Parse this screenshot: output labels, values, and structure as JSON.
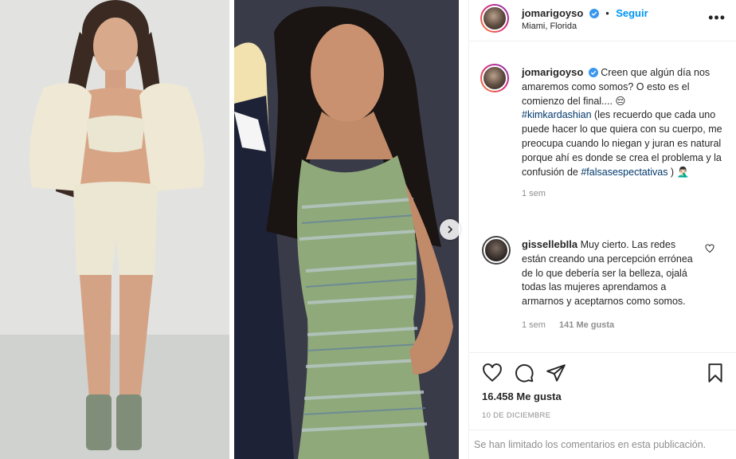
{
  "post": {
    "author": "jomarigoyso",
    "follow_label": "Seguir",
    "separator": "•",
    "location": "Miami, Florida",
    "more_label": "•••"
  },
  "caption": {
    "author": "jomarigoyso",
    "text_part1": "Creen que algún día nos amaremos como somos? O esto es el comienzo del final.... 😔",
    "hashtag1": "#kimkardashian",
    "text_part2": " (les recuerdo que cada uno puede hacer lo que quiera con su cuerpo, me preocupa cuando lo niegan y juran es natural porque ahí es donde se crea el problema y la confusión de ",
    "hashtag2": "#falsasespectativas",
    "text_part3": " ) 🤦🏻‍♂️",
    "time": "1 sem"
  },
  "comments": [
    {
      "author": "gissellebIla",
      "text": "Muy cierto. Las redes están creando una percepción errónea de lo que debería ser la belleza, ojalá todas las mujeres aprendamos a armarnos y aceptarnos como somos.",
      "time": "1 sem",
      "likes": "141 Me gusta"
    }
  ],
  "actions": {
    "likes": "16.458 Me gusta",
    "date": "10 DE DICIEMBRE",
    "limited_notice": "Se han limitado los comentarios en esta publicación."
  },
  "colors": {
    "accent": "#0095f6",
    "hashtag": "#00376b",
    "muted": "#8e8e8e",
    "text": "#262626"
  },
  "icons": {
    "verified": "verified-badge-icon",
    "like": "heart-icon",
    "comment": "comment-icon",
    "share": "paper-plane-icon",
    "save": "bookmark-icon",
    "next": "chevron-right-icon"
  }
}
